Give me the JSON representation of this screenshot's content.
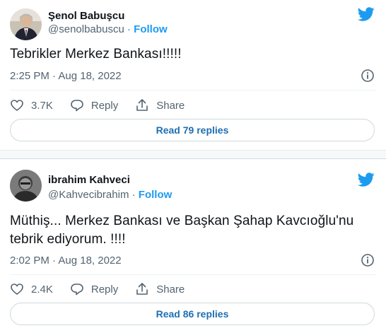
{
  "tweets": [
    {
      "name": "Şenol Babuşcu",
      "handle": "@senolbabuscu",
      "separator": "·",
      "follow": "Follow",
      "text": "Tebrikler Merkez Bankası!!!!!",
      "time": "2:25 PM · Aug 18, 2022",
      "likes": "3.7K",
      "reply": "Reply",
      "share": "Share",
      "read_replies": "Read 79 replies"
    },
    {
      "name": "ibrahim Kahveci",
      "handle": "@Kahvecibrahim",
      "separator": "·",
      "follow": "Follow",
      "text": "Müthiş... Merkez Bankası ve Başkan Şahap Kavcıoğlu'nu tebrik ediyorum. !!!!",
      "time": "2:02 PM · Aug 18, 2022",
      "likes": "2.4K",
      "reply": "Reply",
      "share": "Share",
      "read_replies": "Read 86 replies"
    }
  ],
  "colors": {
    "accent": "#1d9bf0",
    "secondary_text": "#536471",
    "border": "#cfd9de"
  },
  "icons": [
    "twitter-bird-icon",
    "info-icon",
    "heart-icon",
    "reply-icon",
    "share-icon"
  ]
}
